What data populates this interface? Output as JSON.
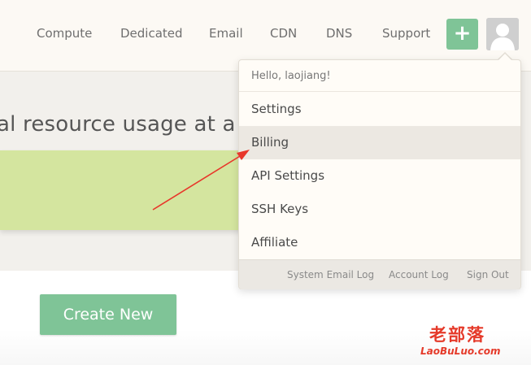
{
  "nav": {
    "items": [
      {
        "label": "Compute"
      },
      {
        "label": "Dedicated"
      },
      {
        "label": "Email"
      },
      {
        "label": "CDN"
      },
      {
        "label": "DNS"
      },
      {
        "label": "Support"
      }
    ],
    "add_label": "+"
  },
  "hero": {
    "heading": "al resource usage at a",
    "create_label": "Create New"
  },
  "user_menu": {
    "greeting": "Hello, laojiang!",
    "items": [
      {
        "label": "Settings"
      },
      {
        "label": "Billing"
      },
      {
        "label": "API Settings"
      },
      {
        "label": "SSH Keys"
      },
      {
        "label": "Affiliate"
      }
    ],
    "active_item": "Billing",
    "footer_links": [
      {
        "label": "System Email Log"
      },
      {
        "label": "Account Log"
      },
      {
        "label": "Sign Out"
      }
    ]
  },
  "watermark": {
    "cn": "老部落",
    "en": "LaoBuLuo.com"
  },
  "colors": {
    "accent_green": "#7fc497",
    "panel_green": "#d4e59f",
    "annotation_red": "#e8362a"
  }
}
